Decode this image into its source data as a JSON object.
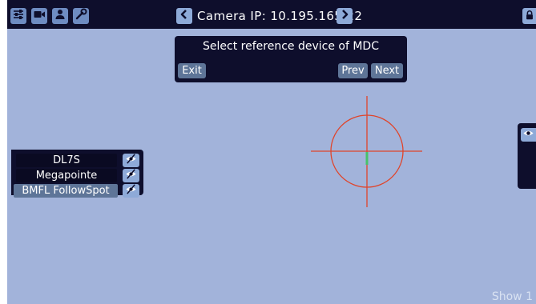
{
  "topbar": {
    "title": "Camera IP: 10.195.165.22",
    "buttons": [
      "sliders-icon",
      "camera-icon",
      "user-icon",
      "wrench-icon"
    ]
  },
  "mdc_panel": {
    "title": "Select reference device of MDC",
    "exit_label": "Exit",
    "prev_label": "Prev",
    "next_label": "Next"
  },
  "devices": [
    {
      "name": "DL7S",
      "visibility_icon": "eye-off-icon"
    },
    {
      "name": "Megapointe",
      "visibility_icon": "eye-off-icon"
    },
    {
      "name": "BMFL FollowSpot",
      "visibility_icon": "eye-off-icon"
    }
  ],
  "right_panel": {
    "visibility_icon": "eye-icon"
  },
  "footer": {
    "show_label": "Show 1"
  },
  "colors": {
    "background": "#a2b3da",
    "panel": "#0e0e2c",
    "button": "#8eaad8",
    "crosshair": "#e0442a",
    "marker": "#47c26a"
  }
}
